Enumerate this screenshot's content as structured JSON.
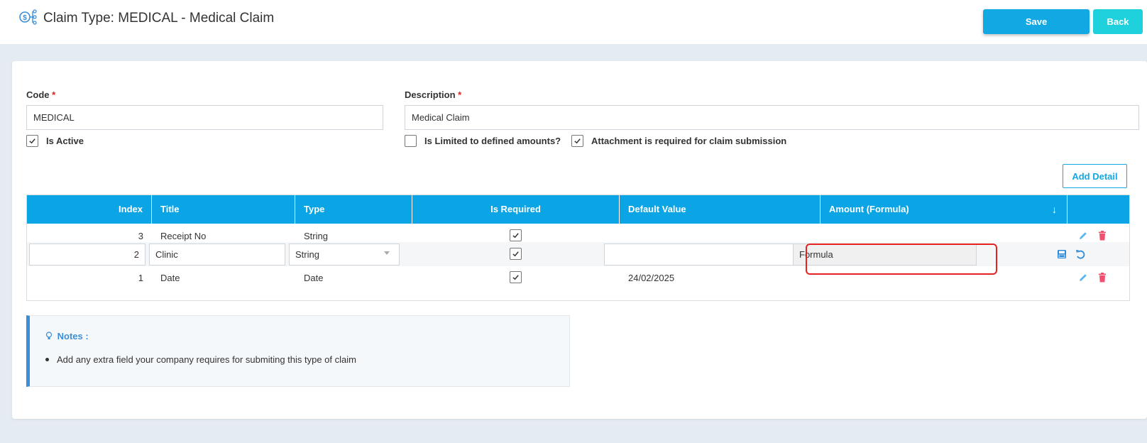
{
  "header": {
    "title": "Claim Type: MEDICAL - Medical Claim",
    "save_label": "Save",
    "back_label": "Back"
  },
  "form": {
    "code_label": "Code",
    "code_value": "MEDICAL",
    "description_label": "Description",
    "description_value": "Medical Claim",
    "is_active_label": "Is Active",
    "is_active_checked": true,
    "is_limited_label": "Is Limited to defined amounts?",
    "is_limited_checked": false,
    "attachment_label": "Attachment is required for claim submission",
    "attachment_checked": true,
    "required_mark": "*"
  },
  "details": {
    "add_label": "Add Detail",
    "sort_icon": "↓",
    "columns": [
      "Index",
      "Title",
      "Type",
      "Is Required",
      "Default Value",
      "Amount (Formula)"
    ],
    "rows": [
      {
        "index": "3",
        "title": "Receipt No",
        "type": "String",
        "is_required": true,
        "default_value": "",
        "amount": "",
        "editing": false
      },
      {
        "index": "2",
        "title": "Clinic",
        "type": "String",
        "is_required": true,
        "default_value": "",
        "amount": "Formula",
        "editing": true
      },
      {
        "index": "1",
        "title": "Date",
        "type": "Date",
        "is_required": true,
        "default_value": "24/02/2025",
        "amount": "",
        "editing": false
      }
    ]
  },
  "notes": {
    "title": "Notes :",
    "items": [
      "Add any extra field your company requires for submiting this type of claim"
    ]
  },
  "colors": {
    "primary": "#12a8e3",
    "back": "#1fd1dd",
    "header_bg": "#0ba5e5",
    "delete": "#f0506e",
    "highlight": "#e52222"
  }
}
